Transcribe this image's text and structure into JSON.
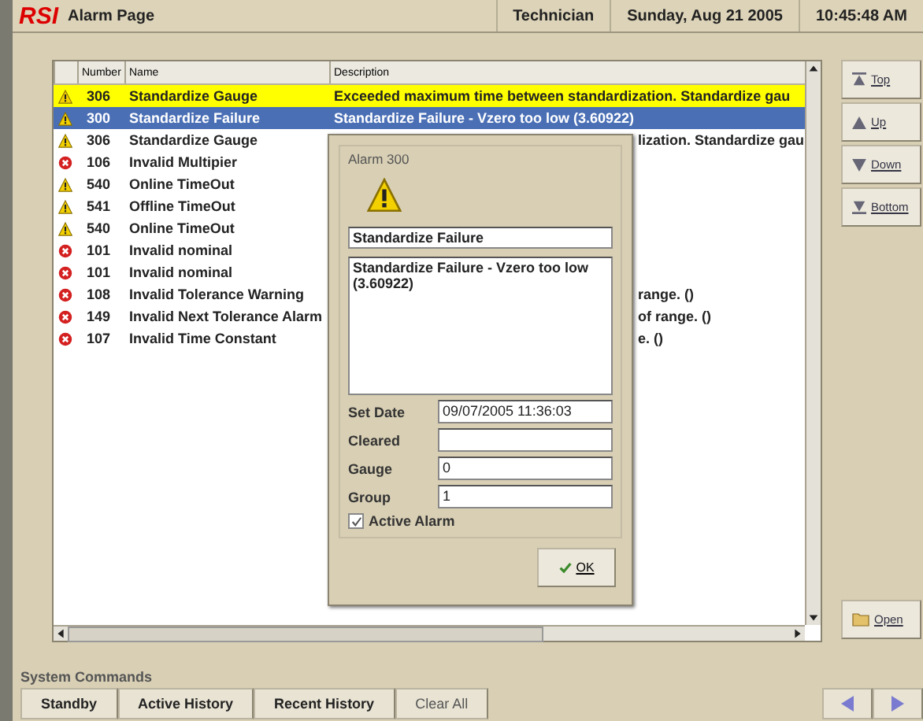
{
  "title_bar": {
    "logo": "RSI",
    "title": "Alarm Page",
    "user": "Technician",
    "date": "Sunday, Aug 21 2005",
    "time": "10:45:48 AM"
  },
  "table": {
    "columns": [
      "Number",
      "Name",
      "Description"
    ],
    "rows": [
      {
        "kind": "warning",
        "number": "306",
        "name": "Standardize Gauge",
        "description": "Exceeded maximum time between standardization.  Standardize gau",
        "flagged": true,
        "selected": false,
        "covered": false
      },
      {
        "kind": "warning",
        "number": "300",
        "name": "Standardize Failure",
        "description": "Standardize Failure - Vzero too low (3.60922)",
        "flagged": false,
        "selected": true,
        "covered": false
      },
      {
        "kind": "warning",
        "number": "306",
        "name": "Standardize Gauge",
        "description": "lization.  Standardize gau",
        "flagged": false,
        "selected": false,
        "covered": true
      },
      {
        "kind": "error",
        "number": "106",
        "name": "Invalid Multipier",
        "flagged": false,
        "selected": false
      },
      {
        "kind": "warning",
        "number": "540",
        "name": "Online TimeOut",
        "flagged": false,
        "selected": false
      },
      {
        "kind": "warning",
        "number": "541",
        "name": "Offline TimeOut",
        "flagged": false,
        "selected": false
      },
      {
        "kind": "warning",
        "number": "540",
        "name": "Online TimeOut",
        "flagged": false,
        "selected": false
      },
      {
        "kind": "error",
        "number": "101",
        "name": "Invalid nominal",
        "flagged": false,
        "selected": false
      },
      {
        "kind": "error",
        "number": "101",
        "name": "Invalid nominal",
        "flagged": false,
        "selected": false
      },
      {
        "kind": "error",
        "number": "108",
        "name": "Invalid Tolerance Warning",
        "description": "range. ()",
        "flagged": false,
        "selected": false,
        "covered": true
      },
      {
        "kind": "error",
        "number": "149",
        "name": "Invalid Next Tolerance Alarm",
        "description": "of range. ()",
        "flagged": false,
        "selected": false,
        "covered": true
      },
      {
        "kind": "error",
        "number": "107",
        "name": "Invalid Time Constant",
        "description": "e. ()",
        "flagged": false,
        "selected": false,
        "covered": true
      }
    ]
  },
  "side_buttons": [
    {
      "kind": "top",
      "label": "Top"
    },
    {
      "kind": "up",
      "label": "Up"
    },
    {
      "kind": "down",
      "label": "Down"
    },
    {
      "kind": "bottom",
      "label": "Bottom"
    }
  ],
  "open_button": "Open",
  "dialog": {
    "title": "Alarm 300",
    "name": "Standardize Failure",
    "description": "Standardize Failure - Vzero too low (3.60922)",
    "fields": [
      {
        "label": "Set Date",
        "value": "09/07/2005 11:36:03"
      },
      {
        "label": "Cleared"
      },
      {
        "label": "Gauge",
        "value": "0"
      },
      {
        "label": "Group",
        "value": "1"
      }
    ],
    "active_alarm": {
      "label": "Active Alarm",
      "checked": true
    },
    "ok": "OK"
  },
  "system_commands": {
    "title": "System Commands",
    "buttons": [
      {
        "label": "Standby",
        "disabled": false
      },
      {
        "label": "Active History",
        "disabled": false
      },
      {
        "label": "Recent History",
        "disabled": false
      },
      {
        "label": "Clear All",
        "disabled": true
      }
    ]
  }
}
